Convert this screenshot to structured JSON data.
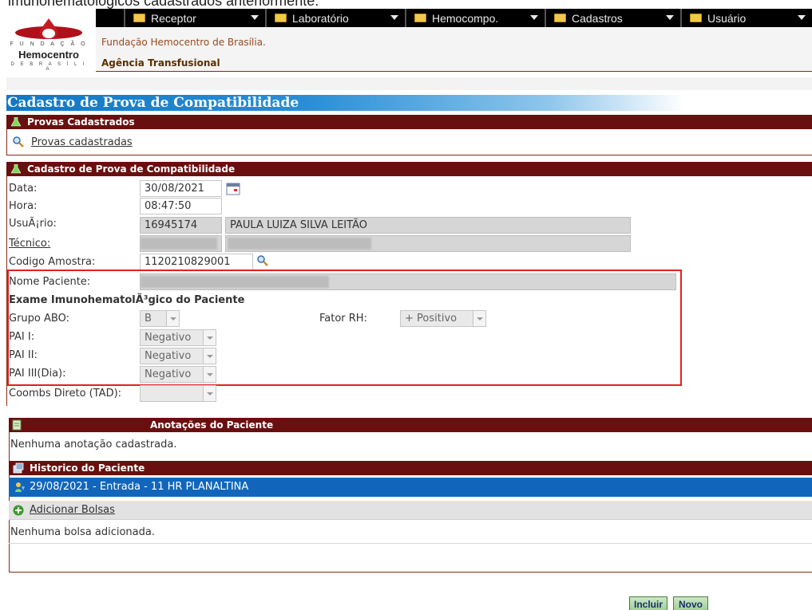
{
  "top_caption": "imunohematológicos cadastrados anteriormente.",
  "logo": {
    "small_text": "F U N D A Ç Ã O",
    "big_text": "Hemocentro",
    "bottom_text": "D E  B R A S Í L I A"
  },
  "menu": [
    {
      "label": "Receptor"
    },
    {
      "label": "Laboratório"
    },
    {
      "label": "Hemocompo."
    },
    {
      "label": "Cadastros"
    },
    {
      "label": "Usuário"
    }
  ],
  "header": {
    "foundation": "Fundação Hemocentro de Brasília.",
    "agency": "Agência Transfusional"
  },
  "page_title": "Cadastro de Prova de Compatibilidade",
  "provas": {
    "section_title": "Provas Cadastrados",
    "link": "Provas cadastradas"
  },
  "cadastro": {
    "section_title": "Cadastro de Prova de Compatibilidade",
    "data_label": "Data:",
    "data_value": "30/08/2021",
    "hora_label": "Hora:",
    "hora_value": "08:47:50",
    "usuario_label": "UsuÃ¡rio:",
    "usuario_id": "16945174",
    "usuario_name": "PAULA LUIZA SILVA LEITÃO",
    "tecnico_label": "Técnico:",
    "codigo_label": "Codigo Amostra:",
    "codigo_value": "1120210829001",
    "nome_label": "Nome Paciente:",
    "exame_title": "Exame ImunohematolÃ³gico do Paciente",
    "grupo_label": "Grupo ABO:",
    "grupo_value": "B",
    "fator_label": "Fator RH:",
    "fator_value": "+ Positivo",
    "pai1_label": "PAI I:",
    "pai1_value": "Negativo",
    "pai2_label": "PAI II:",
    "pai2_value": "Negativo",
    "pai3_label": "PAI III(Dia):",
    "pai3_value": "Negativo",
    "coombs_label": "Coombs Direto (TAD):",
    "coombs_value": ""
  },
  "anotacoes": {
    "section_title": "Anotações do Paciente",
    "empty_text": "Nenhuma anotação cadastrada."
  },
  "historico": {
    "section_title": "Historico do Paciente",
    "entry": "29/08/2021 - Entrada - 11 HR PLANALTINA"
  },
  "bolsas": {
    "add_link": "Adicionar Bolsas",
    "empty_text": "Nenhuma bolsa adicionada."
  },
  "buttons": {
    "incluir": "Incluir",
    "novo": "Novo"
  },
  "colors": {
    "section_bar": "#6a0f0f",
    "title_blue": "#1177c4",
    "history_row": "#1166bb",
    "highlight": "#e02020"
  }
}
